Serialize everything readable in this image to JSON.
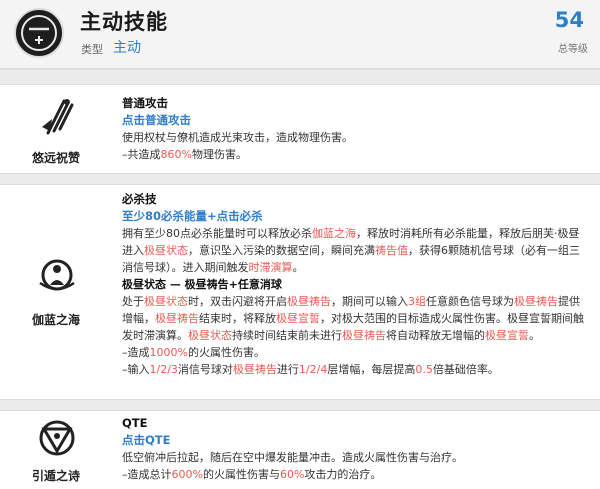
{
  "header": {
    "title": "主动技能",
    "type_label": "类型",
    "type_value": "主动",
    "level": "54",
    "level_label": "总等级"
  },
  "skills": [
    {
      "name": "悠远祝赞",
      "icon": "staff-cross-icon",
      "title": "普通攻击",
      "command": "点击普通攻击",
      "desc": "使用权杖与僚机造成光束攻击，造成物理伤害。",
      "dmg_prefix": "–共造成",
      "dmg_value": "860%",
      "dmg_suffix": "物理伤害。"
    },
    {
      "name": "伽蓝之海",
      "icon": "ring-figure-icon",
      "title": "必杀技",
      "command": "至少80必杀能量+点击必杀",
      "p1": [
        {
          "t": "拥有至少80点必杀能量时可以释放必杀",
          "c": ""
        },
        {
          "t": "伽蓝之海",
          "c": "r"
        },
        {
          "t": "，释放时消耗所有必杀能量，释放后朋芙·极昼进入",
          "c": ""
        },
        {
          "t": "极昼状态",
          "c": "r"
        },
        {
          "t": "，意识坠入污染的数据空间，瞬间充满",
          "c": ""
        },
        {
          "t": "祷告值",
          "c": "r"
        },
        {
          "t": "，获得6颗随机信号球（必有一组三消信号球）。进入期间触发",
          "c": ""
        },
        {
          "t": "时滞演算",
          "c": "r"
        },
        {
          "t": "。",
          "c": ""
        }
      ],
      "state_title": "极昼状态 — 极昼祷告+任意消球",
      "p2": [
        {
          "t": "处于",
          "c": ""
        },
        {
          "t": "极昼状态",
          "c": "r"
        },
        {
          "t": "时，双击闪避将开启",
          "c": ""
        },
        {
          "t": "极昼祷告",
          "c": "r"
        },
        {
          "t": "，期间可以输入",
          "c": ""
        },
        {
          "t": "3组",
          "c": "r"
        },
        {
          "t": "任意颜色信号球为",
          "c": ""
        },
        {
          "t": "极昼祷告",
          "c": "r"
        },
        {
          "t": "提供增幅，",
          "c": ""
        },
        {
          "t": "极昼祷告",
          "c": "r"
        },
        {
          "t": "结束时，将释放",
          "c": ""
        },
        {
          "t": "极昼宣誓",
          "c": "r"
        },
        {
          "t": "，对极大范围的目标造成火属性伤害。极昼宣誓期间触发时滞演算。",
          "c": ""
        },
        {
          "t": "极昼状态",
          "c": "r"
        },
        {
          "t": "持续时间结束前未进行",
          "c": ""
        },
        {
          "t": "极昼祷告",
          "c": "r"
        },
        {
          "t": "将自动释放无增幅的",
          "c": ""
        },
        {
          "t": "极昼宣誓",
          "c": "r"
        },
        {
          "t": "。",
          "c": ""
        }
      ],
      "l1_prefix": "–造成",
      "l1_value": "1000%",
      "l1_suffix": "的火属性伤害。",
      "l2": [
        {
          "t": "–输入",
          "c": ""
        },
        {
          "t": "1/2/3",
          "c": "r"
        },
        {
          "t": "消信号球对",
          "c": ""
        },
        {
          "t": "极昼祷告",
          "c": "r"
        },
        {
          "t": "进行",
          "c": ""
        },
        {
          "t": "1/2/4",
          "c": "r"
        },
        {
          "t": "层增幅，每层提高",
          "c": ""
        },
        {
          "t": "0.5",
          "c": "r"
        },
        {
          "t": "倍基础倍率。",
          "c": ""
        }
      ]
    },
    {
      "name": "引遁之诗",
      "icon": "triangle-sigil-icon",
      "title": "QTE",
      "command": "点击QTE",
      "desc": "低空俯冲后拉起，随后在空中爆发能量冲击。造成火属性伤害与治疗。",
      "l": [
        {
          "t": "–造成总计",
          "c": ""
        },
        {
          "t": "600%",
          "c": "r"
        },
        {
          "t": "的火属性伤害与",
          "c": ""
        },
        {
          "t": "60%",
          "c": "r"
        },
        {
          "t": "攻击力的治疗。",
          "c": ""
        }
      ]
    }
  ],
  "colors": {
    "accent": "#2f7ec8",
    "highlight": "#e85b54",
    "separator": "#ebebeb"
  }
}
